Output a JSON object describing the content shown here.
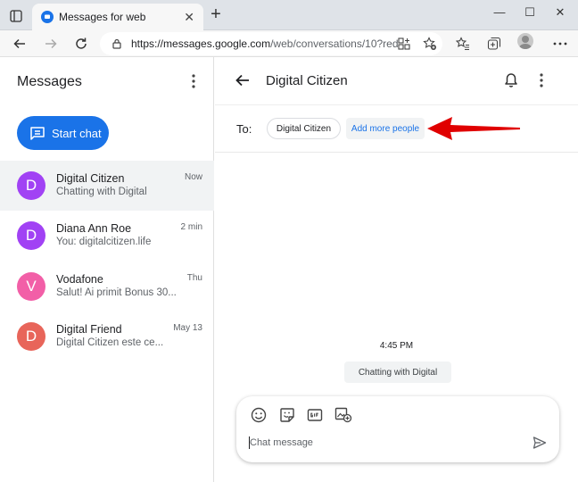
{
  "browser": {
    "tab_title": "Messages for web",
    "url_host": "https://messages.google.com",
    "url_rest": "/web/conversations/10?red...",
    "colors": {
      "tab_bar": "#dfe3e8",
      "toolbar": "#f7f7f7"
    }
  },
  "sidebar": {
    "title": "Messages",
    "start_chat_label": "Start chat",
    "conversations": [
      {
        "initial": "D",
        "name": "Digital Citizen",
        "snippet": "Chatting with Digital",
        "time": "Now",
        "color": "#a142f4",
        "selected": true
      },
      {
        "initial": "D",
        "name": "Diana Ann Roe",
        "snippet": "You: digitalcitizen.life",
        "time": "2 min",
        "color": "#a142f4",
        "selected": false
      },
      {
        "initial": "V",
        "name": "Vodafone",
        "snippet": "Salut! Ai primit Bonus 30...",
        "time": "Thu",
        "color": "#f25fa7",
        "selected": false
      },
      {
        "initial": "D",
        "name": "Digital Friend",
        "snippet": "Digital Citizen este ce...",
        "time": "May 13",
        "color": "#e8655a",
        "selected": false
      }
    ]
  },
  "conversation": {
    "title": "Digital Citizen",
    "to_label": "To:",
    "recipient_chip": "Digital Citizen",
    "add_people_label": "Add more people",
    "message_time": "4:45 PM",
    "message_text": "Chatting with Digital",
    "composer_placeholder": "Chat message"
  },
  "accent_color": "#1a73e8",
  "annotation_color": "#e00000"
}
